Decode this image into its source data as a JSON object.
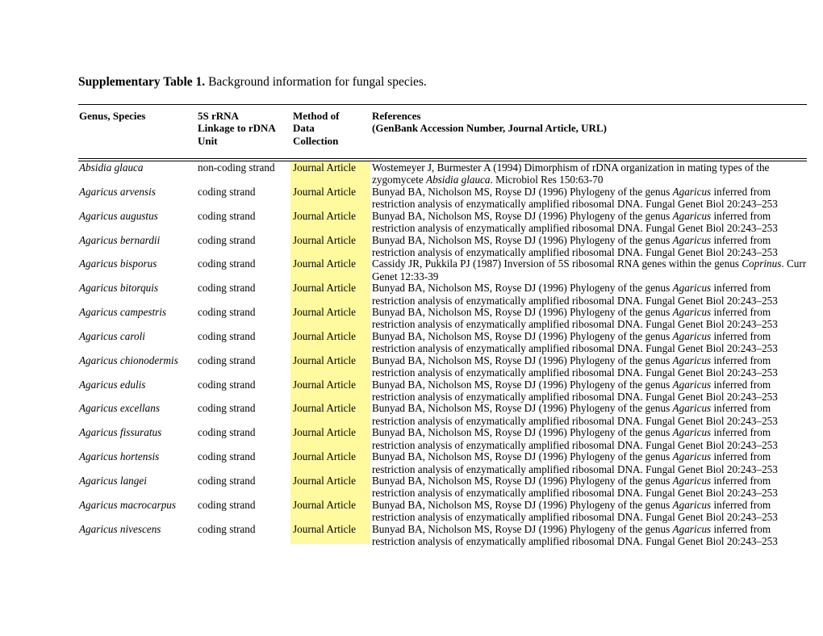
{
  "document": {
    "title_label": "Supplementary Table 1.",
    "title_rest": " Background information for fungal species."
  },
  "colors": {
    "highlight": "#fffa9e",
    "rule": "#000000",
    "text": "#000000"
  },
  "table": {
    "columns": [
      {
        "id": "species",
        "lines": [
          "Genus, Species",
          "",
          ""
        ]
      },
      {
        "id": "strand",
        "lines": [
          "5S rRNA",
          "Linkage to rDNA",
          "Unit"
        ]
      },
      {
        "id": "method",
        "lines": [
          "Method of",
          "Data",
          "Collection"
        ]
      },
      {
        "id": "reference",
        "lines": [
          "References",
          "(GenBank Accession Number,  Journal Article, URL)",
          ""
        ]
      }
    ],
    "column_headers": {
      "species": "Genus, Species",
      "strand_l1": "5S rRNA",
      "strand_l2": "Linkage to rDNA",
      "strand_l3": "Unit",
      "method_l1": "Method of",
      "method_l2": "Data",
      "method_l3": "Collection",
      "reference_l1": "References",
      "reference_l2": "(GenBank Accession Number,  Journal Article, URL)"
    },
    "rows": [
      {
        "species": "Absidia glauca",
        "strand": "non-coding strand",
        "method": "Journal Article",
        "reference_pre": "Wostemeyer J, Burmester A (1994) Dimorphism of rDNA organization in mating types of the zygomycete ",
        "reference_italic": "Absidia glauca",
        "reference_post": ". Microbiol Res 150:63-70"
      },
      {
        "species": "Agaricus arvensis",
        "strand": "coding strand",
        "method": "Journal Article",
        "reference_pre": "Bunyad BA, Nicholson MS, Royse DJ (1996) Phylogeny of the genus ",
        "reference_italic": "Agaricus",
        "reference_post": " inferred from restriction analysis of enzymatically amplified ribosomal DNA. Fungal Genet Biol 20:243–253"
      },
      {
        "species": "Agaricus augustus",
        "strand": "coding strand",
        "method": "Journal Article",
        "reference_pre": "Bunyad BA, Nicholson MS, Royse DJ (1996) Phylogeny of the genus ",
        "reference_italic": "Agaricus",
        "reference_post": " inferred from restriction analysis of enzymatically amplified ribosomal DNA. Fungal Genet Biol 20:243–253"
      },
      {
        "species": "Agaricus bernardii",
        "strand": "coding strand",
        "method": "Journal Article",
        "reference_pre": "Bunyad BA, Nicholson MS, Royse DJ (1996) Phylogeny of the genus ",
        "reference_italic": "Agaricus",
        "reference_post": " inferred from restriction analysis of enzymatically amplified ribosomal DNA. Fungal Genet Biol 20:243–253"
      },
      {
        "species": "Agaricus bisporus",
        "strand": "coding strand",
        "method": "Journal Article",
        "reference_pre": "Cassidy JR, Pukkila PJ (1987) Inversion of 5S ribosomal RNA genes within the genus ",
        "reference_italic": "Coprinus",
        "reference_post": ". Curr Genet 12:33-39"
      },
      {
        "species": "Agaricus bitorquis",
        "strand": "coding strand",
        "method": "Journal Article",
        "reference_pre": "Bunyad BA, Nicholson MS, Royse DJ (1996) Phylogeny of the genus ",
        "reference_italic": "Agaricus",
        "reference_post": " inferred from restriction analysis of enzymatically amplified ribosomal DNA. Fungal Genet Biol 20:243–253"
      },
      {
        "species": "Agaricus campestris",
        "strand": "coding strand",
        "method": "Journal Article",
        "reference_pre": "Bunyad BA, Nicholson MS, Royse DJ (1996) Phylogeny of the genus ",
        "reference_italic": "Agaricus",
        "reference_post": " inferred from restriction analysis of enzymatically amplified ribosomal DNA. Fungal Genet Biol 20:243–253"
      },
      {
        "species": "Agaricus caroli",
        "strand": "coding strand",
        "method": "Journal Article",
        "reference_pre": "Bunyad BA, Nicholson MS, Royse DJ (1996) Phylogeny of the genus ",
        "reference_italic": "Agaricus",
        "reference_post": " inferred from restriction analysis of enzymatically amplified ribosomal DNA. Fungal Genet Biol 20:243–253"
      },
      {
        "species": "Agaricus chionodermis",
        "strand": "coding strand",
        "method": "Journal Article",
        "reference_pre": "Bunyad BA, Nicholson MS, Royse DJ (1996) Phylogeny of the genus ",
        "reference_italic": "Agaricus",
        "reference_post": " inferred from restriction analysis of enzymatically amplified ribosomal DNA. Fungal Genet Biol 20:243–253"
      },
      {
        "species": "Agaricus edulis",
        "strand": "coding strand",
        "method": "Journal Article",
        "reference_pre": "Bunyad BA, Nicholson MS, Royse DJ (1996) Phylogeny of the genus ",
        "reference_italic": "Agaricus",
        "reference_post": " inferred from restriction analysis of enzymatically amplified ribosomal DNA. Fungal Genet Biol 20:243–253"
      },
      {
        "species": "Agaricus excellans",
        "strand": "coding strand",
        "method": "Journal Article",
        "reference_pre": "Bunyad BA, Nicholson MS, Royse DJ (1996) Phylogeny of the genus ",
        "reference_italic": "Agaricus",
        "reference_post": " inferred from restriction analysis of enzymatically amplified ribosomal DNA. Fungal Genet Biol 20:243–253"
      },
      {
        "species": "Agaricus fissuratus",
        "strand": "coding strand",
        "method": "Journal Article",
        "reference_pre": "Bunyad BA, Nicholson MS, Royse DJ (1996) Phylogeny of the genus ",
        "reference_italic": "Agaricus",
        "reference_post": " inferred from restriction analysis of enzymatically amplified ribosomal DNA. Fungal Genet Biol 20:243–253"
      },
      {
        "species": "Agaricus hortensis",
        "strand": "coding strand",
        "method": "Journal Article",
        "reference_pre": "Bunyad BA, Nicholson MS, Royse DJ (1996) Phylogeny of the genus ",
        "reference_italic": "Agaricus",
        "reference_post": " inferred from restriction analysis of enzymatically amplified ribosomal DNA. Fungal Genet Biol 20:243–253"
      },
      {
        "species": "Agaricus langei",
        "strand": "coding strand",
        "method": "Journal Article",
        "reference_pre": "Bunyad BA, Nicholson MS, Royse DJ (1996) Phylogeny of the genus ",
        "reference_italic": "Agaricus",
        "reference_post": " inferred from restriction analysis of enzymatically amplified ribosomal DNA. Fungal Genet Biol 20:243–253"
      },
      {
        "species": "Agaricus macrocarpus",
        "strand": "coding strand",
        "method": "Journal Article",
        "reference_pre": "Bunyad BA, Nicholson MS, Royse DJ (1996) Phylogeny of the genus ",
        "reference_italic": "Agaricus",
        "reference_post": " inferred from restriction analysis of enzymatically amplified ribosomal DNA. Fungal Genet Biol 20:243–253"
      },
      {
        "species": "Agaricus nivescens",
        "strand": "coding strand",
        "method": "Journal Article",
        "reference_pre": "Bunyad BA, Nicholson MS, Royse DJ (1996) Phylogeny of the genus ",
        "reference_italic": "Agaricus",
        "reference_post": " inferred from restriction analysis of enzymatically amplified ribosomal DNA. Fungal Genet Biol 20:243–253"
      }
    ]
  }
}
